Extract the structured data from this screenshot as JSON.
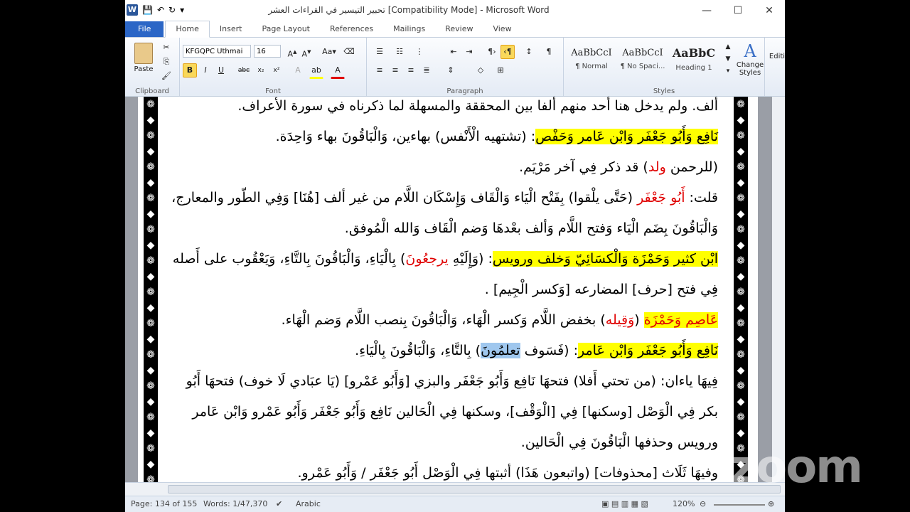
{
  "window": {
    "title": "تحبير التيسير في القراءات العشر [Compatibility Mode] - Microsoft Word",
    "minimize": "—",
    "maximize": "☐",
    "close": "✕"
  },
  "quick_access": {
    "app_icon": "W",
    "save": "💾",
    "undo": "↶",
    "redo": "↻",
    "customize": "▾"
  },
  "tabs": [
    "File",
    "Home",
    "Insert",
    "Page Layout",
    "References",
    "Mailings",
    "Review",
    "View"
  ],
  "ribbon": {
    "clipboard": {
      "label": "Clipboard",
      "paste": "Paste"
    },
    "font": {
      "label": "Font",
      "font_name": "KFGQPC Uthmai",
      "font_size": "16"
    },
    "paragraph": {
      "label": "Paragraph"
    },
    "styles": {
      "label": "Styles",
      "items": [
        {
          "sample": "AaBbCcI",
          "name": "¶ Normal"
        },
        {
          "sample": "AaBbCcI",
          "name": "¶ No Spaci..."
        },
        {
          "sample": "AaBbC",
          "name": "Heading 1"
        }
      ],
      "change_styles": "Change Styles",
      "editing": "Editi"
    }
  },
  "document": {
    "lines": [
      {
        "id": "l0",
        "parts": [
          {
            "t": "ألف. ولم يدخل هنا أحد منهم ألفا بين المحققة والمسهلة لما ذكرناه في سورة الأعراف."
          }
        ]
      },
      {
        "id": "l1",
        "parts": [
          {
            "t": "نَافِع وَأَبُو جَعْفَر وَابْن عَامر وَحَفْص",
            "c": "y"
          },
          {
            "t": ": (تشتهيه الْأَنْفس) بهاءين، وَالْبَاقُونَ بهاء وَاحِدَة."
          }
        ]
      },
      {
        "id": "l2",
        "parts": [
          {
            "t": "(للرحمن "
          },
          {
            "t": "ولد",
            "c": "red"
          },
          {
            "t": ") قد ذكر فِي آخر مَرْيَم."
          }
        ]
      },
      {
        "id": "l3",
        "parts": [
          {
            "t": "قلت: "
          },
          {
            "t": "أَبُو جَعْفَر",
            "c": "red"
          },
          {
            "t": " (حَتَّى يلْقوا) بِفَتْح الْيَاء وَالْقَاف وَإِسْكَان اللَّام من غير ألف [هُنَا] وَفِي الطّور والمعارج،"
          }
        ]
      },
      {
        "id": "l4",
        "parts": [
          {
            "t": "وَالْبَاقُونَ بِضَم الْيَاء وَفتح اللَّام وَألف بعْدهَا وَضم الْقَاف وَالله الْمُوفق."
          }
        ]
      },
      {
        "id": "l5",
        "parts": [
          {
            "t": "ابْن كثير وَحَمْزَة وَالْكسَائِيّ وَخلف ورويس",
            "c": "y"
          },
          {
            "t": ": (وَإِلَيْهِ "
          },
          {
            "t": "يرجعُونَ",
            "c": "red"
          },
          {
            "t": ") بِالْيَاءِ، وَالْبَاقُونَ بِالتَّاءِ، وَيَعْقُوب على أَصله"
          }
        ]
      },
      {
        "id": "l6",
        "parts": [
          {
            "t": "فِي فتح [حرف] المضارعه [وَكسر الْجِيم] ."
          }
        ]
      },
      {
        "id": "l7",
        "parts": [
          {
            "t": "عَاصِم وَحَمْزَة",
            "c": "y red"
          },
          {
            "t": " ("
          },
          {
            "t": "وَقِيله",
            "c": "red"
          },
          {
            "t": ") بخفض اللَّام وَكسر الْهَاء، وَالْبَاقُونَ بِنصب اللَّام وَضم الْهَاء."
          }
        ]
      },
      {
        "id": "l8",
        "parts": [
          {
            "t": "نَافِع وَأَبُو جَعْفَر وَابْن عَامر",
            "c": "y"
          },
          {
            "t": ": (فَسَوف "
          },
          {
            "t": "تعلمُونَ",
            "c": "sel"
          },
          {
            "t": ") بِالتَّاءِ، وَالْبَاقُونَ بِالْيَاءِ."
          }
        ]
      },
      {
        "id": "l9",
        "parts": [
          {
            "t": "فِيهَا ياءان: (من تحتي أَفلا) فتحهَا نَافِع وَأَبُو جَعْفَر والبزي [وَأَبُو عَمْرو] (يَا عبَادي لَا خوف) فتحهَا أَبُو"
          }
        ]
      },
      {
        "id": "l10",
        "parts": [
          {
            "t": "بكر فِي الْوَصْل [وسكنها] فِي [الْوَقْف]، وسكنها فِي الْحَالين نَافِع وَأَبُو جَعْفَر وَأَبُو عَمْرو وَابْن عَامر"
          }
        ]
      },
      {
        "id": "l11",
        "parts": [
          {
            "t": "ورويس وحذفها الْبَاقُونَ فِي الْحَالين."
          }
        ]
      },
      {
        "id": "l12",
        "parts": [
          {
            "t": "وفيهَا ثَلَاث [محذوفات] (واتبعون هَذَا) أثبتها فِي الْوَصْل أَبُو جَعْفَر / وَأَبُو عَمْرو."
          }
        ]
      }
    ]
  },
  "status_bar": {
    "page": "Page: 134 of 155",
    "words": "Words: 1/47,370",
    "language": "Arabic",
    "zoom": "120%"
  },
  "watermark": "zoom"
}
